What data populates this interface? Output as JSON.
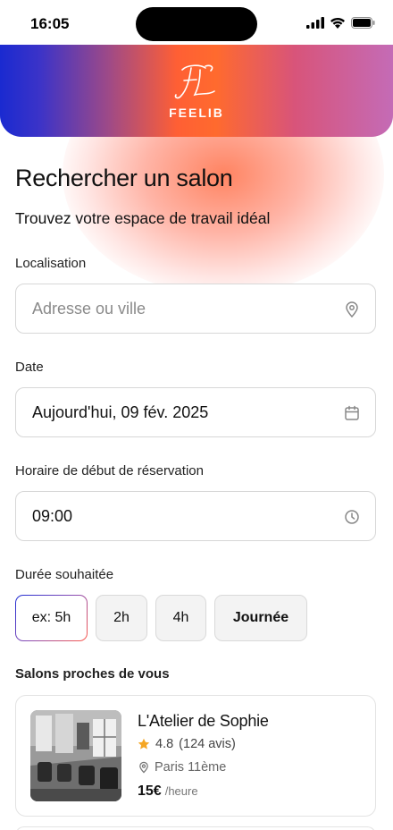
{
  "status_bar": {
    "time": "16:05"
  },
  "header": {
    "title": "FEELIB",
    "logo": "FL-monogram"
  },
  "search": {
    "title": "Rechercher un salon",
    "subtitle": "Trouvez votre espace de travail idéal",
    "location": {
      "label": "Localisation",
      "placeholder": "Adresse ou ville",
      "value": "",
      "icon": "location-pin-icon"
    },
    "date": {
      "label": "Date",
      "value": "Aujourd'hui, 09 fév. 2025",
      "icon": "calendar-icon"
    },
    "start_time": {
      "label": "Horaire de début de réservation",
      "value": "09:00",
      "icon": "clock-icon"
    },
    "duration": {
      "label": "Durée souhaitée",
      "options": [
        {
          "label": "ex: 5h",
          "selected": true
        },
        {
          "label": "2h",
          "selected": false
        },
        {
          "label": "4h",
          "selected": false
        },
        {
          "label": "Journée",
          "selected": false
        }
      ]
    }
  },
  "nearby": {
    "title": "Salons proches de vous",
    "salons": [
      {
        "name": "L'Atelier de Sophie",
        "rating": "4.8",
        "reviews": "(124 avis)",
        "location": "Paris 11ème",
        "price": "15€",
        "price_unit": "/heure"
      }
    ]
  },
  "colors": {
    "star": "#f5a623",
    "accent_gradient_start": "#1b2bd4",
    "accent_gradient_end": "#ff5a4a"
  }
}
